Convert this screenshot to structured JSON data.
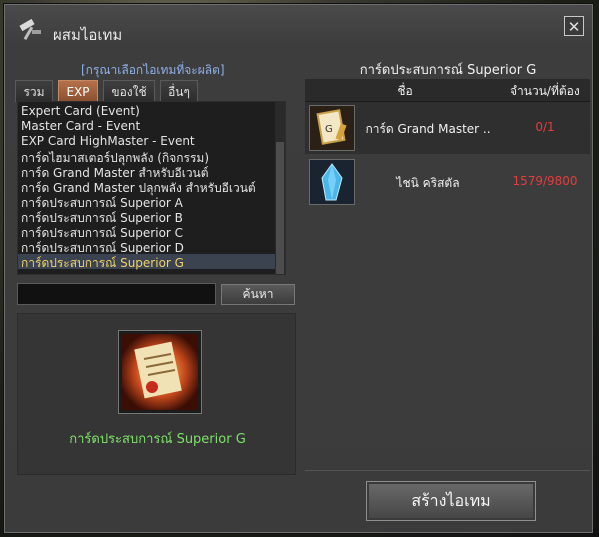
{
  "window": {
    "title": "ผสมไอเทม",
    "close_label": "✕"
  },
  "left": {
    "hint": "[กรุณาเลือกไอเทมที่จะผลิต]",
    "tabs": [
      {
        "label": "รวม",
        "active": false
      },
      {
        "label": "EXP",
        "active": true
      },
      {
        "label": "ของใช้",
        "active": false
      },
      {
        "label": "อื่นๆ",
        "active": false
      }
    ],
    "items": [
      "Expert Card (Event)",
      "Master Card - Event",
      "EXP Card HighMaster - Event",
      "การ์ดไฮมาสเตอร์ปลุกพลัง (กิจกรรม)",
      "การ์ด Grand Master สำหรับอีเวนต์",
      "การ์ด Grand Master ปลุกพลัง สำหรับอีเวนต์",
      "การ์ดประสบการณ์ Superior A",
      "การ์ดประสบการณ์ Superior B",
      "การ์ดประสบการณ์ Superior C",
      "การ์ดประสบการณ์ Superior D",
      "การ์ดประสบการณ์ Superior G"
    ],
    "selected_index": 10,
    "search": {
      "value": "",
      "button_label": "ค้นหา"
    },
    "preview": {
      "icon": "exp-card-icon",
      "name": "การ์ดประสบการณ์ Superior G"
    }
  },
  "right": {
    "title": "การ์ดประสบการณ์ Superior G",
    "headers": {
      "name": "ชื่อ",
      "quantity": "จำนวน/ที่ต้อง"
    },
    "materials": [
      {
        "icon": "grand-master-card-icon",
        "name": "การ์ด Grand Master ..",
        "qty": "0/1"
      },
      {
        "icon": "blue-crystal-icon",
        "name": "ไชนิ คริสตัล",
        "qty": "1579/9800"
      }
    ],
    "create_label": "สร้างไอเทม"
  },
  "colors": {
    "selected_text": "#f0d26a",
    "insufficient_qty": "#e33d3d",
    "preview_name": "#7ee06a",
    "hint": "#8fb0e6"
  }
}
